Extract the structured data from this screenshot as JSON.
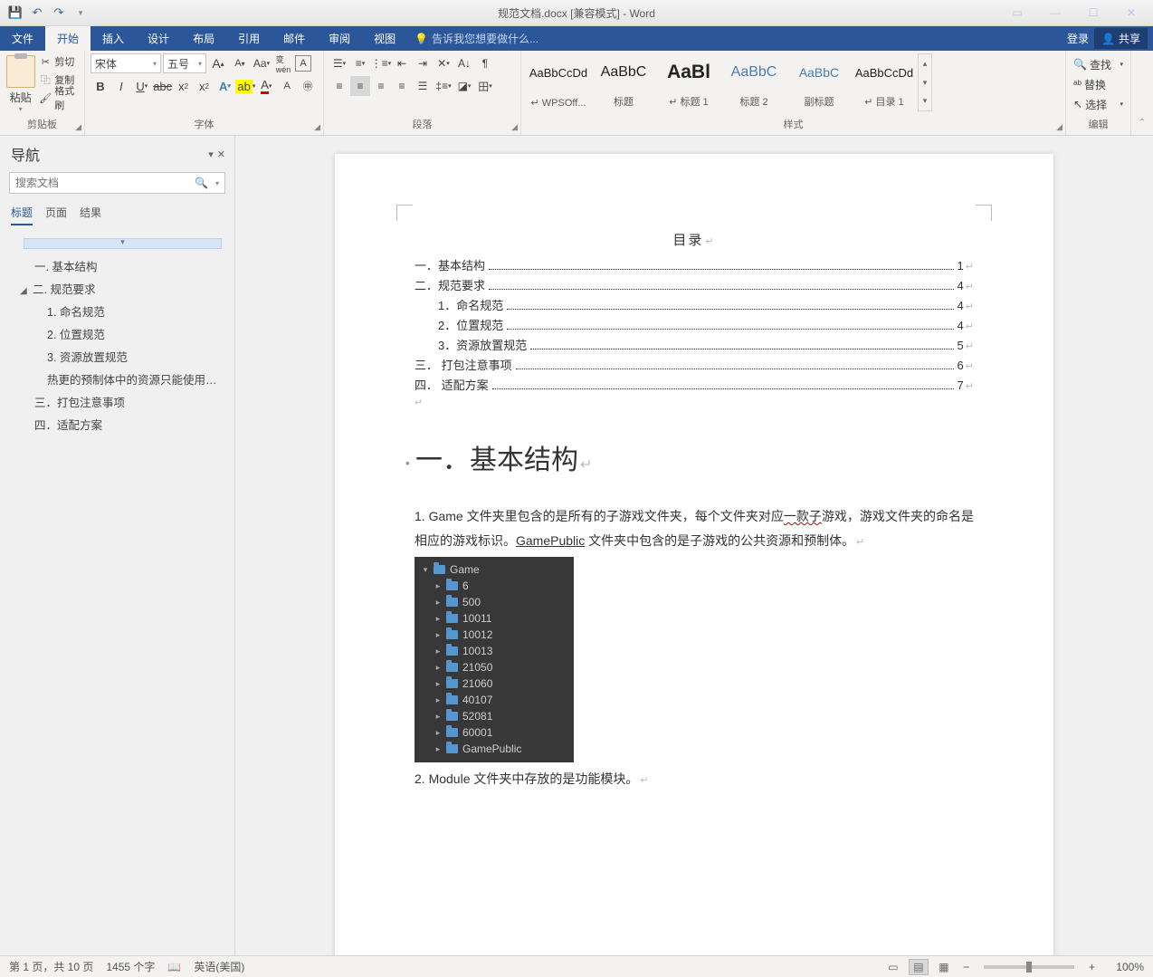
{
  "titlebar": {
    "title": "规范文档.docx [兼容模式] - Word"
  },
  "ribbonTabs": {
    "file": "文件",
    "home": "开始",
    "insert": "插入",
    "design": "设计",
    "layout": "布局",
    "references": "引用",
    "mailings": "邮件",
    "review": "审阅",
    "view": "视图",
    "tellme": "告诉我您想要做什么...",
    "login": "登录",
    "share": "共享"
  },
  "clipboard": {
    "paste": "粘贴",
    "cut": "剪切",
    "copy": "复制",
    "formatPainter": "格式刷",
    "label": "剪贴板"
  },
  "font": {
    "name": "宋体",
    "size": "五号",
    "label": "字体"
  },
  "paragraph": {
    "label": "段落"
  },
  "styles": {
    "label": "样式",
    "items": [
      {
        "preview": "AaBbCcDd",
        "cls": "sp-normal",
        "label": "↵ WPSOff..."
      },
      {
        "preview": "AaBbC",
        "cls": "sp-title",
        "label": "标题"
      },
      {
        "preview": "AaBl",
        "cls": "sp-heading",
        "label": "↵ 标题 1"
      },
      {
        "preview": "AaBbC",
        "cls": "sp-h1",
        "label": "标题 2"
      },
      {
        "preview": "AaBbC",
        "cls": "sp-h2",
        "label": "副标题"
      },
      {
        "preview": "AaBbCcDd",
        "cls": "sp-normal",
        "label": "↵ 目录 1"
      }
    ]
  },
  "editing": {
    "find": "查找",
    "replace": "替换",
    "select": "选择",
    "label": "编辑"
  },
  "navPane": {
    "title": "导航",
    "searchPlaceholder": "搜索文档",
    "tabs": {
      "headings": "标题",
      "pages": "页面",
      "results": "结果"
    },
    "tree": [
      {
        "lvl": 1,
        "text": "一. 基本结构"
      },
      {
        "lvl": 1,
        "exp": true,
        "text": "二. 规范要求"
      },
      {
        "lvl": 2,
        "text": "1. 命名规范"
      },
      {
        "lvl": 2,
        "text": "2. 位置规范"
      },
      {
        "lvl": 2,
        "text": "3. 资源放置规范"
      },
      {
        "lvl": 2,
        "text": "热更的预制体中的资源只能使用此..."
      },
      {
        "lvl": 1,
        "text": "三．打包注意事项"
      },
      {
        "lvl": 1,
        "text": "四．适配方案"
      }
    ]
  },
  "document": {
    "tocTitle": "目录",
    "toc": [
      {
        "lvl": 0,
        "text": "一．基本结构",
        "page": "1"
      },
      {
        "lvl": 0,
        "text": "二．规范要求",
        "page": "4"
      },
      {
        "lvl": 1,
        "text": "1．命名规范",
        "page": "4"
      },
      {
        "lvl": 1,
        "text": "2．位置规范",
        "page": "4"
      },
      {
        "lvl": 1,
        "text": "3．资源放置规范",
        "page": "5"
      },
      {
        "lvl": 0,
        "text": "三．  打包注意事项",
        "page": "6"
      },
      {
        "lvl": 0,
        "text": "四．  适配方案",
        "page": "7"
      }
    ],
    "h1": "一．基本结构",
    "p1a": "1.  Game  文件夹里包含的是所有的子游戏文件夹，每个文件夹对应",
    "p1u": "一款子",
    "p1b": "游戏，游戏文件夹的命名是相应的游戏标识。",
    "p1link": "GamePublic",
    "p1c": " 文件夹中包含的是子游戏的公共资源和预制体。",
    "folders": [
      "6",
      "500",
      "10011",
      "10012",
      "10013",
      "21050",
      "21060",
      "40107",
      "52081",
      "60001",
      "GamePublic"
    ],
    "rootFolder": "Game",
    "p2": "2.  Module 文件夹中存放的是功能模块。"
  },
  "statusbar": {
    "page": "第 1 页，共 10 页",
    "words": "1455 个字",
    "lang": "英语(美国)",
    "zoom": "100%"
  }
}
